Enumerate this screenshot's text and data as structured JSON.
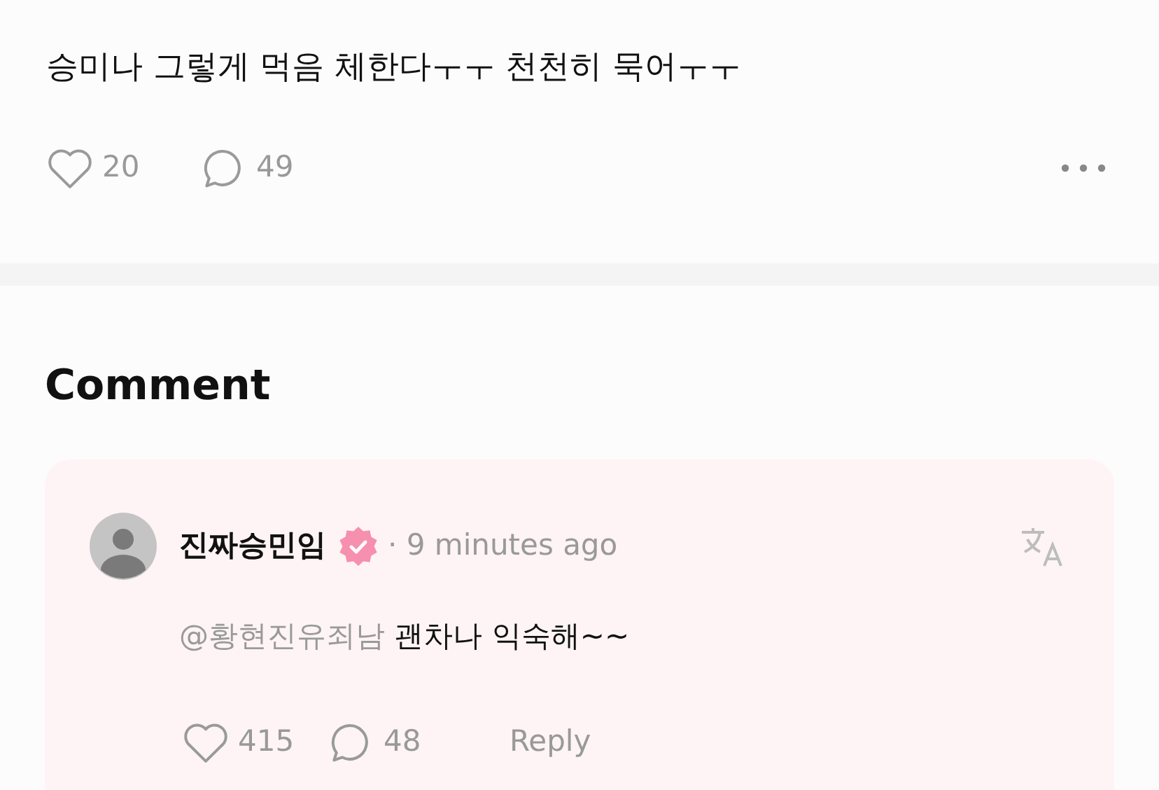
{
  "post": {
    "text": "승미나 그렇게 먹음 체한다ㅜㅜ 천천히 묵어ㅜㅜ",
    "likes": "20",
    "comments": "49"
  },
  "comment_section": {
    "title": "Comment",
    "comments": [
      {
        "author": "진짜승민임",
        "verified": true,
        "time": "· 9 minutes ago",
        "mention": "@황현진유죄남",
        "text": "괜차나 익숙해~~",
        "likes": "415",
        "replies": "48",
        "reply_label": "Reply"
      }
    ]
  }
}
